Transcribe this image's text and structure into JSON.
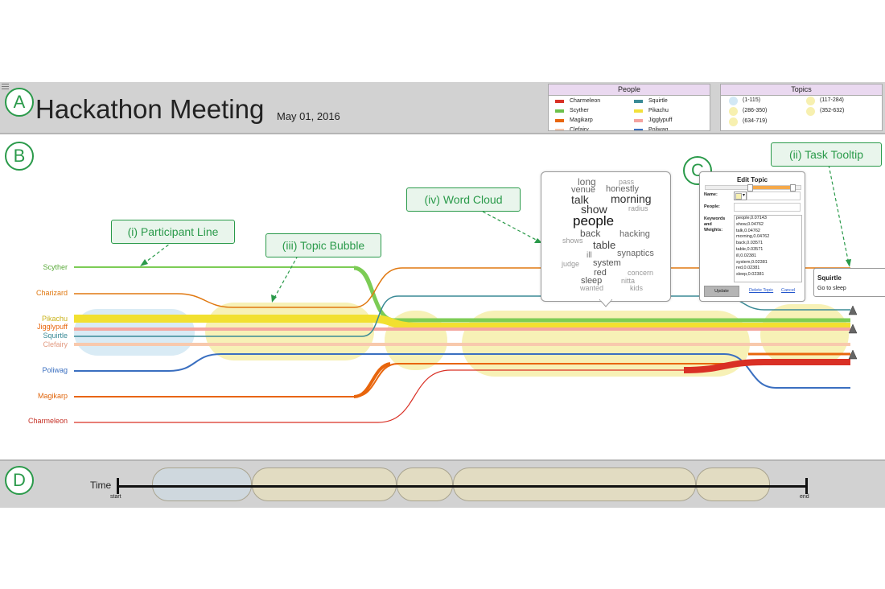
{
  "markers": {
    "a": "A",
    "b": "B",
    "c": "C",
    "d": "D"
  },
  "header": {
    "title": "Hackathon Meeting",
    "date": "May 01, 2016"
  },
  "people_legend": {
    "title": "People",
    "items": [
      {
        "name": "Charmeleon",
        "color": "#d93025"
      },
      {
        "name": "Squirtle",
        "color": "#3a8a96"
      },
      {
        "name": "Scyther",
        "color": "#6cc04a"
      },
      {
        "name": "Pikachu",
        "color": "#f2e03a"
      },
      {
        "name": "Magikarp",
        "color": "#e8650c"
      },
      {
        "name": "Jigglypuff",
        "color": "#f4a3a0"
      },
      {
        "name": "Clefairy",
        "color": "#f6c4a8"
      },
      {
        "name": "Poliwag",
        "color": "#3a6fc0"
      }
    ]
  },
  "topics_legend": {
    "title": "Topics",
    "items": [
      {
        "label": "(1-115)",
        "color": "#d3e8f5"
      },
      {
        "label": "(117-284)",
        "color": "#f7f0b0"
      },
      {
        "label": "(286-350)",
        "color": "#f7f0b0"
      },
      {
        "label": "(352-632)",
        "color": "#f7f0b0"
      },
      {
        "label": "(634-719)",
        "color": "#f7f0b0"
      }
    ]
  },
  "participants": [
    {
      "name": "Scyther",
      "color": "#5aaa3a"
    },
    {
      "name": "Charizard",
      "color": "#e07810"
    },
    {
      "name": "Pikachu",
      "color": "#c9b21a"
    },
    {
      "name": "Jigglypuff",
      "color": "#e8650c"
    },
    {
      "name": "Squirtle",
      "color": "#3a8a96"
    },
    {
      "name": "Clefairy",
      "color": "#e29a80"
    },
    {
      "name": "Poliwag",
      "color": "#3a6fc0"
    },
    {
      "name": "Magikarp",
      "color": "#e0650c"
    },
    {
      "name": "Charmeleon",
      "color": "#c53025"
    }
  ],
  "callouts": {
    "participant_line": "(i) Participant Line",
    "topic_bubble": "(iii) Topic Bubble",
    "word_cloud": "(iv) Word Cloud",
    "task_tooltip": "(ii) Task Tooltip"
  },
  "word_cloud": {
    "words": [
      {
        "text": "long",
        "size": 12,
        "color": "#666"
      },
      {
        "text": "pass",
        "size": 9,
        "color": "#999"
      },
      {
        "text": "venue",
        "size": 11,
        "color": "#666"
      },
      {
        "text": "honestly",
        "size": 11,
        "color": "#666"
      },
      {
        "text": "talk",
        "size": 14,
        "color": "#333"
      },
      {
        "text": "morning",
        "size": 14,
        "color": "#333"
      },
      {
        "text": "show",
        "size": 14,
        "color": "#333"
      },
      {
        "text": "radius",
        "size": 9,
        "color": "#999"
      },
      {
        "text": "people",
        "size": 17,
        "color": "#111"
      },
      {
        "text": "back",
        "size": 12,
        "color": "#555"
      },
      {
        "text": "hacking",
        "size": 11,
        "color": "#666"
      },
      {
        "text": "shows",
        "size": 9,
        "color": "#999"
      },
      {
        "text": "table",
        "size": 13,
        "color": "#444"
      },
      {
        "text": "synaptics",
        "size": 11,
        "color": "#666"
      },
      {
        "text": "ill",
        "size": 10,
        "color": "#777"
      },
      {
        "text": "judge",
        "size": 9,
        "color": "#999"
      },
      {
        "text": "system",
        "size": 11,
        "color": "#555"
      },
      {
        "text": "red",
        "size": 11,
        "color": "#555"
      },
      {
        "text": "concern",
        "size": 9,
        "color": "#999"
      },
      {
        "text": "sleep",
        "size": 11,
        "color": "#555"
      },
      {
        "text": "nitta",
        "size": 9,
        "color": "#999"
      },
      {
        "text": "wanted",
        "size": 9,
        "color": "#999"
      },
      {
        "text": "kids",
        "size": 9,
        "color": "#999"
      }
    ]
  },
  "edit_topic": {
    "title": "Edit Topic",
    "name_label": "Name:",
    "people_label": "People:",
    "keywords_label_1": "Keywords",
    "keywords_label_2": "and",
    "keywords_label_3": "Weights:",
    "keywords": [
      "people,0.07143",
      "show,0.04762",
      "talk,0.04762",
      "morning,0.04762",
      "back,0.03571",
      "table,0.03571",
      "ill,0.02381",
      "system,0.02381",
      "red,0.02381",
      "sleep,0.02381"
    ],
    "update_label": "Update",
    "delete_label": "Delete Topic",
    "cancel_label": "Cancel",
    "swatch_color": "#f7f0b0"
  },
  "task_tooltip": {
    "name": "Squirtle",
    "task": "Go to sleep"
  },
  "timeline": {
    "label": "Time",
    "start": "start",
    "end": "end"
  }
}
